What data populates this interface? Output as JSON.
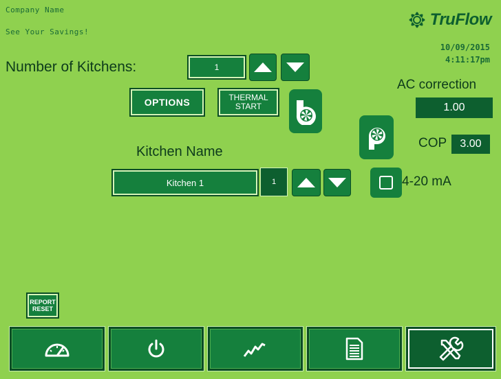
{
  "header": {
    "company": "Company Name",
    "tagline": "See Your Savings!",
    "brand": "TruFlow",
    "date": "10/09/2015",
    "time": "4:11:17pm"
  },
  "kitchens": {
    "label": "Number of Kitchens:",
    "value": "1"
  },
  "buttons": {
    "options": "OPTIONS",
    "thermal_line1": "THERMAL",
    "thermal_line2": "START",
    "report_line1": "REPORT",
    "report_line2": "RESET"
  },
  "ac": {
    "label": "AC correction",
    "value": "1.00"
  },
  "cop": {
    "label": "COP",
    "value": "3.00"
  },
  "kitchen_name": {
    "label": "Kitchen Name",
    "value": "Kitchen 1",
    "index": "1"
  },
  "mode": {
    "label": "4-20 mA",
    "checked": false
  },
  "nav": [
    {
      "name": "dashboard",
      "icon": "gauge-icon"
    },
    {
      "name": "power",
      "icon": "power-icon"
    },
    {
      "name": "trend",
      "icon": "trend-icon"
    },
    {
      "name": "report",
      "icon": "document-icon"
    },
    {
      "name": "settings",
      "icon": "tools-icon",
      "active": true
    }
  ],
  "colors": {
    "background": "#8fd14f",
    "button": "#15803d",
    "dark": "#0d5f2f"
  }
}
